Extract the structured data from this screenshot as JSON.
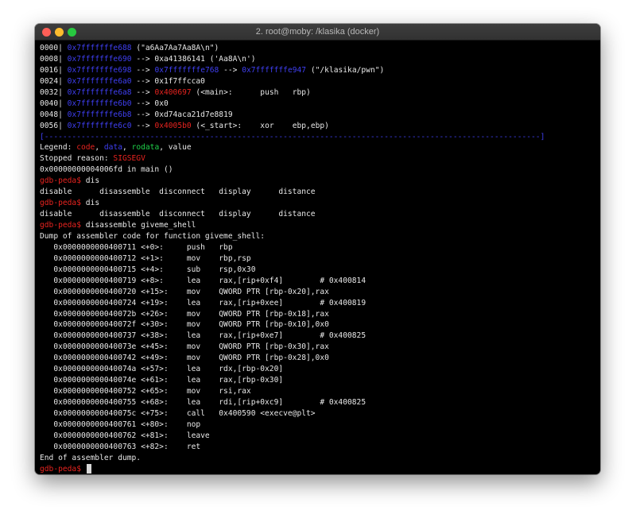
{
  "window": {
    "title": "2. root@moby: /klasika (docker)"
  },
  "stack": [
    {
      "off": "0000|",
      "addr": "0x7fffffffe688",
      "rest": " (\"a6Aa7Aa7Aa8A\\n\")"
    },
    {
      "off": "0008|",
      "addr": "0x7fffffffe690",
      "rest": " --> 0xa41386141 ('Aa8A\\n')"
    },
    {
      "off": "0016|",
      "addr": "0x7fffffffe698",
      "arrow": " --> ",
      "addr2": "0x7fffffffe768",
      "arrow2": " --> ",
      "addr3": "0x7fffffffe947",
      "rest": " (\"/klasika/pwn\")"
    },
    {
      "off": "0024|",
      "addr": "0x7fffffffe6a0",
      "rest": " --> 0x1f7ffcca0"
    },
    {
      "off": "0032|",
      "addr": "0x7fffffffe6a8",
      "arrow": " --> ",
      "code": "0x400697",
      "rest": " (<main>:      push   rbp)"
    },
    {
      "off": "0040|",
      "addr": "0x7fffffffe6b0",
      "rest": " --> 0x0"
    },
    {
      "off": "0048|",
      "addr": "0x7fffffffe6b8",
      "rest": " --> 0xd74aca21d7e8819"
    },
    {
      "off": "0056|",
      "addr": "0x7fffffffe6c0",
      "arrow": " --> ",
      "code": "0x4005b0",
      "rest": " (<_start>:    xor    ebp,ebp)"
    }
  ],
  "separator": "[------------------------------------------------------------------------------------------------------------]",
  "legend": {
    "label": "Legend: ",
    "code": "code",
    "c1": ", ",
    "data": "data",
    "c2": ", ",
    "rodata": "rodata",
    "c3": ", ",
    "value": "value"
  },
  "stopped": {
    "label": "Stopped reason: ",
    "reason": "SIGSEGV"
  },
  "location": "0x00000000004006fd in main ()",
  "prompt": "gdb-peda$ ",
  "cmd1": "dis",
  "completions1": "disable      disassemble  disconnect   display      distance",
  "cmd2": "dis",
  "completions2": "disable      disassemble  disconnect   display      distance",
  "cmd3": "disassemble giveme_shell",
  "dump_header": "Dump of assembler code for function giveme_shell:",
  "asm": [
    "   0x0000000000400711 <+0>:     push   rbp",
    "   0x0000000000400712 <+1>:     mov    rbp,rsp",
    "   0x0000000000400715 <+4>:     sub    rsp,0x30",
    "   0x0000000000400719 <+8>:     lea    rax,[rip+0xf4]        # 0x400814",
    "   0x0000000000400720 <+15>:    mov    QWORD PTR [rbp-0x20],rax",
    "   0x0000000000400724 <+19>:    lea    rax,[rip+0xee]        # 0x400819",
    "   0x000000000040072b <+26>:    mov    QWORD PTR [rbp-0x18],rax",
    "   0x000000000040072f <+30>:    mov    QWORD PTR [rbp-0x10],0x0",
    "   0x0000000000400737 <+38>:    lea    rax,[rip+0xe7]        # 0x400825",
    "   0x000000000040073e <+45>:    mov    QWORD PTR [rbp-0x30],rax",
    "   0x0000000000400742 <+49>:    mov    QWORD PTR [rbp-0x28],0x0",
    "   0x000000000040074a <+57>:    lea    rdx,[rbp-0x20]",
    "   0x000000000040074e <+61>:    lea    rax,[rbp-0x30]",
    "   0x0000000000400752 <+65>:    mov    rsi,rax",
    "   0x0000000000400755 <+68>:    lea    rdi,[rip+0xc9]        # 0x400825",
    "   0x000000000040075c <+75>:    call   0x400590 <execve@plt>",
    "   0x0000000000400761 <+80>:    nop",
    "   0x0000000000400762 <+81>:    leave",
    "   0x0000000000400763 <+82>:    ret"
  ],
  "dump_footer": "End of assembler dump.",
  "colors": {
    "code": "#e8231f",
    "data": "#3f3ff2",
    "rodata": "#1fd14a",
    "text": "#e8e8e8",
    "background": "#000000"
  }
}
